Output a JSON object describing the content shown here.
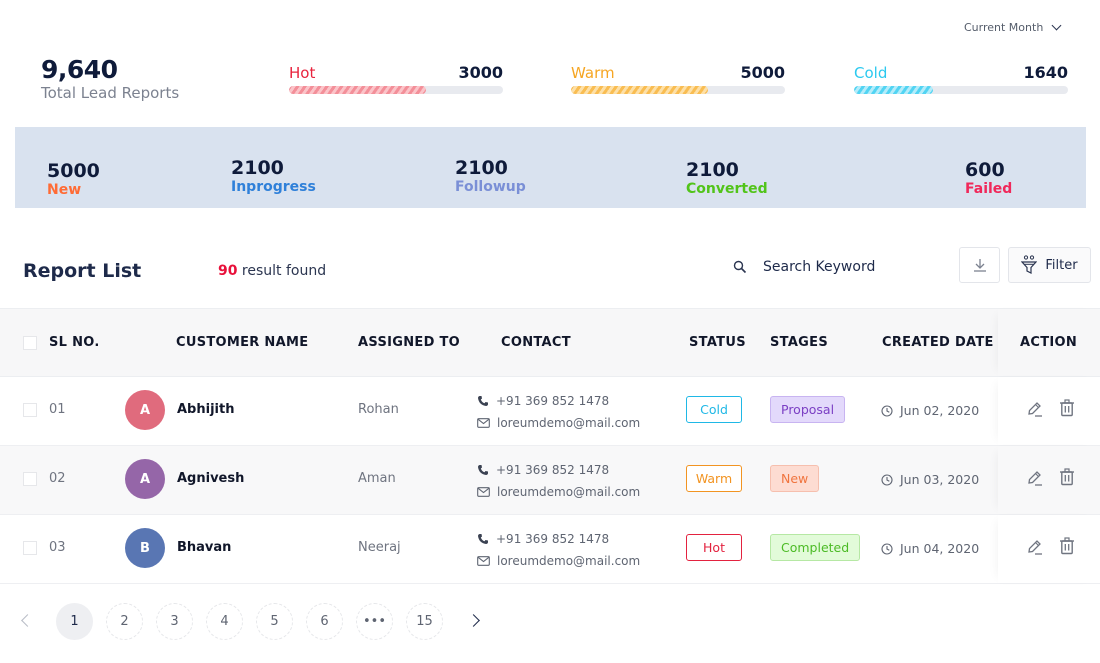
{
  "period_selector": {
    "label": "Current Month"
  },
  "summary": {
    "total_value": "9,640",
    "total_label": "Total Lead Reports",
    "meters": [
      {
        "name": "Hot",
        "value": "3000",
        "fill_percent": 64,
        "color": "#e8233d"
      },
      {
        "name": "Warm",
        "value": "5000",
        "fill_percent": 64,
        "color": "#f6a623"
      },
      {
        "name": "Cold",
        "value": "1640",
        "fill_percent": 37,
        "color": "#2bc9ef"
      }
    ]
  },
  "stages": [
    {
      "value": "5000",
      "label": "New",
      "color": "#ff6b35"
    },
    {
      "value": "2100",
      "label": "Inprogress",
      "color": "#2f80d9"
    },
    {
      "value": "2100",
      "label": "Followup",
      "color": "#7a8fd6"
    },
    {
      "value": "2100",
      "label": "Converted",
      "color": "#52c41a"
    },
    {
      "value": "600",
      "label": "Failed",
      "color": "#f0285a"
    }
  ],
  "report": {
    "title": "Report List",
    "result_count": "90",
    "result_suffix": " result found",
    "search_placeholder": "Search Keyword",
    "filter_label": "Filter"
  },
  "table": {
    "columns": [
      "SL NO.",
      "CUSTOMER NAME",
      "ASSIGNED TO",
      "CONTACT",
      "STATUS",
      "STAGES",
      "CREATED DATE",
      "ACTION"
    ],
    "rows": [
      {
        "sl": "01",
        "initial": "A",
        "avatar_color": "#e06b7d",
        "name": "Abhijith",
        "assigned": "Rohan",
        "phone": "+91 369 852 1478",
        "email": "loreumdemo@mail.com",
        "status": "Cold",
        "status_color": "#1fb8e6",
        "stage": "Proposal",
        "stage_color": "#7b3fc4",
        "stage_bg": "#e3d9fb",
        "stage_border": "#c8b4f1",
        "date": "Jun 02, 2020"
      },
      {
        "sl": "02",
        "initial": "A",
        "avatar_color": "#9566a8",
        "name": "Agnivesh",
        "assigned": "Aman",
        "phone": "+91 369 852 1478",
        "email": "loreumdemo@mail.com",
        "status": "Warm",
        "status_color": "#f29422",
        "stage": "New",
        "stage_color": "#f0743e",
        "stage_bg": "#fddcd2",
        "stage_border": "#f6bfae",
        "date": "Jun 03, 2020"
      },
      {
        "sl": "03",
        "initial": "B",
        "avatar_color": "#5976b3",
        "name": "Bhavan",
        "assigned": "Neeraj",
        "phone": "+91 369 852 1478",
        "email": "loreumdemo@mail.com",
        "status": "Hot",
        "status_color": "#e3223f",
        "stage": "Completed",
        "stage_color": "#4cbb26",
        "stage_bg": "#e2fbd9",
        "stage_border": "#b6e8a4",
        "date": "Jun 04, 2020"
      }
    ]
  },
  "pagination": {
    "pages": [
      "1",
      "2",
      "3",
      "4",
      "5",
      "6",
      "•••",
      "15"
    ],
    "current": "1"
  }
}
